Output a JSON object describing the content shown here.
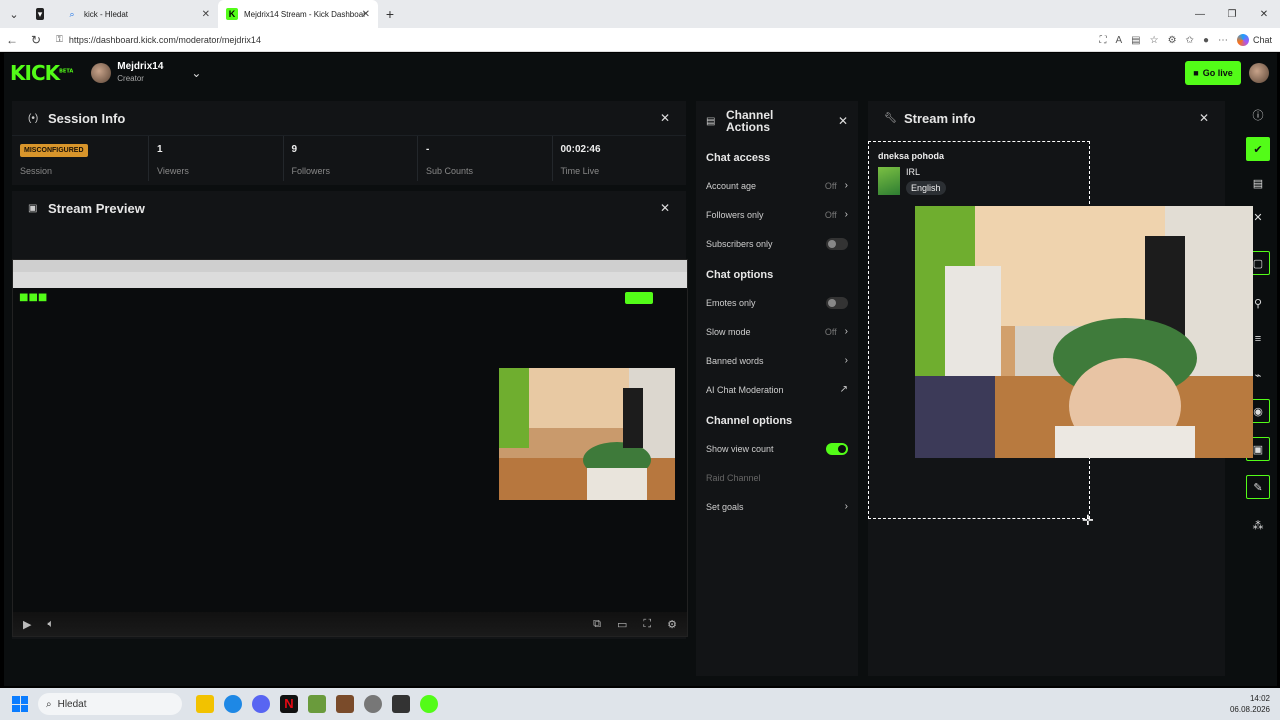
{
  "browser": {
    "tabs": [
      {
        "label": ""
      },
      {
        "label": "kick - Hledat"
      },
      {
        "label": "Mejdrix14 Stream - Kick Dashboar"
      }
    ],
    "url": "https://dashboard.kick.com/moderator/mejdrix14",
    "copilot_label": "Chat"
  },
  "app": {
    "logo": "KICK",
    "logo_badge": "BETA",
    "user_name": "Mejdrix14",
    "user_role": "Creator",
    "go_live_label": "Go live"
  },
  "session": {
    "title": "Session Info",
    "status_badge": "MISCONFIGURED",
    "status_label": "Session",
    "stats": [
      {
        "value": "1",
        "label": "Viewers"
      },
      {
        "value": "9",
        "label": "Followers"
      },
      {
        "value": "-",
        "label": "Sub Counts"
      },
      {
        "value": "00:02:46",
        "label": "Time Live"
      }
    ]
  },
  "preview": {
    "title": "Stream Preview"
  },
  "channel_actions": {
    "title_line1": "Channel",
    "title_line2": "Actions",
    "chat_access_title": "Chat access",
    "account_age": {
      "label": "Account age",
      "value": "Off"
    },
    "followers_only": {
      "label": "Followers only",
      "value": "Off"
    },
    "subscribers_only": {
      "label": "Subscribers only"
    },
    "chat_options_title": "Chat options",
    "emotes_only": {
      "label": "Emotes only"
    },
    "slow_mode": {
      "label": "Slow mode",
      "value": "Off"
    },
    "banned_words": {
      "label": "Banned words"
    },
    "ai_moderation": {
      "label": "AI Chat Moderation"
    },
    "channel_options_title": "Channel options",
    "show_view_count": {
      "label": "Show view count",
      "on": true
    },
    "raid_channel": {
      "label": "Raid Channel"
    },
    "set_goals": {
      "label": "Set goals"
    }
  },
  "stream_info": {
    "title": "Stream info",
    "stream_title": "dneksa pohoda",
    "category": "IRL",
    "language": "English"
  },
  "taskbar": {
    "search_placeholder": "Hledat",
    "time": "14:02",
    "date": "06.08.2026"
  },
  "colors": {
    "brand": "#53fc18",
    "warning": "#d8952b",
    "panel": "#121416"
  }
}
